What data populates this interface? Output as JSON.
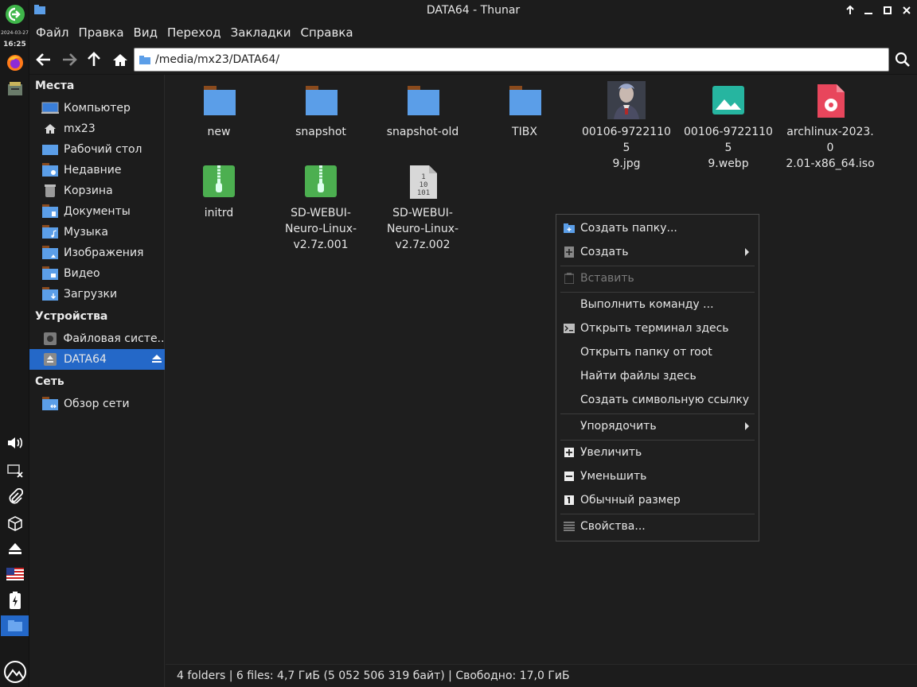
{
  "panel": {
    "date": "2024-03-27",
    "time": "16:25"
  },
  "window": {
    "title": "DATA64 - Thunar"
  },
  "menubar": {
    "items": [
      "Файл",
      "Правка",
      "Вид",
      "Переход",
      "Закладки",
      "Справка"
    ]
  },
  "toolbar": {
    "path": "/media/mx23/DATA64/"
  },
  "sidebar": {
    "places_heading": "Места",
    "places": [
      "Компьютер",
      "mx23",
      "Рабочий стол",
      "Недавние",
      "Корзина",
      "Документы",
      "Музыка",
      "Изображения",
      "Видео",
      "Загрузки"
    ],
    "devices_heading": "Устройства",
    "devices": [
      "Файловая систе...",
      "DATA64"
    ],
    "network_heading": "Сеть",
    "network": [
      "Обзор сети"
    ]
  },
  "files": [
    {
      "name": "new",
      "kind": "folder"
    },
    {
      "name": "snapshot",
      "kind": "folder"
    },
    {
      "name": "snapshot-old",
      "kind": "folder"
    },
    {
      "name": "TIBX",
      "kind": "folder"
    },
    {
      "name": "00106-972211059.jpg",
      "kind": "image-thumbnail"
    },
    {
      "name": "00106-972211059.webp",
      "kind": "image"
    },
    {
      "name": "archlinux-2023.02.01-x86_64.iso",
      "kind": "disc-image"
    },
    {
      "name": "initrd",
      "kind": "archive"
    },
    {
      "name": "SD-WEBUI-Neuro-Linux-v2.7z.001",
      "kind": "archive"
    },
    {
      "name": "SD-WEBUI-Neuro-Linux-v2.7z.002",
      "kind": "binary"
    }
  ],
  "file_labels": {
    "f0": [
      "new"
    ],
    "f1": [
      "snapshot"
    ],
    "f2": [
      "snapshot-old"
    ],
    "f3": [
      "TIBX"
    ],
    "f4": [
      "00106-97221105",
      "9.jpg"
    ],
    "f5": [
      "00106-97221105",
      "9.webp"
    ],
    "f6": [
      "archlinux-2023.0",
      "2.01-x86_64.iso"
    ],
    "f7": [
      "initrd"
    ],
    "f8": [
      "SD-WEBUI-",
      "Neuro-Linux-",
      "v2.7z.001"
    ],
    "f9": [
      "SD-WEBUI-",
      "Neuro-Linux-",
      "v2.7z.002"
    ]
  },
  "statusbar": {
    "text": "4 folders  |  6 files: 4,7 ГиБ (5 052 506 319 байт)  |  Свободно: 17,0 ГиБ"
  },
  "context_menu": {
    "create_folder": "Создать папку...",
    "create": "Создать",
    "paste": "Вставить",
    "run_command": "Выполнить команду ...",
    "open_terminal": "Открыть терминал здесь",
    "open_as_root": "Открыть папку от root",
    "find_files": "Найти файлы здесь",
    "create_symlink": "Создать символьную ссылку",
    "arrange": "Упорядочить",
    "zoom_in": "Увеличить",
    "zoom_out": "Уменьшить",
    "normal_size": "Обычный размер",
    "properties": "Свойства..."
  },
  "colors": {
    "accent": "#2468c8",
    "folder_blue": "#5b9ee8",
    "folder_tab": "#8a4a1c",
    "archive_green": "#4caf50",
    "iso_pink": "#e8465c",
    "image_teal": "#26b5a0"
  }
}
